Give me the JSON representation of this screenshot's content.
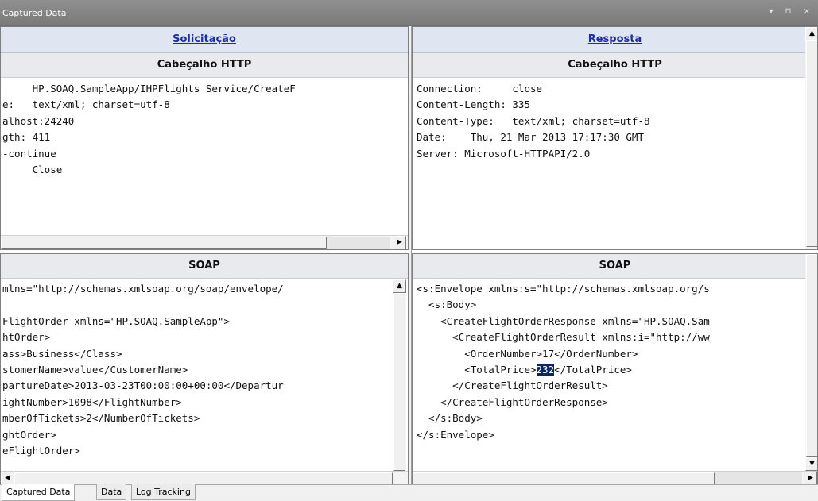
{
  "window": {
    "title": "Captured Data",
    "controls": "▾ ⊓ ×"
  },
  "request": {
    "header": "Solicitação",
    "http_title": "Cabeçalho HTTP",
    "http_lines": [
      "     HP.SOAQ.SampleApp/IHPFlights_Service/CreateF",
      "e:   text/xml; charset=utf-8",
      "alhost:24240",
      "gth: 411",
      "-continue",
      "     Close"
    ],
    "soap_title": "SOAP",
    "soap_lines": [
      "mlns=\"http://schemas.xmlsoap.org/soap/envelope/",
      "",
      "FlightOrder xmlns=\"HP.SOAQ.SampleApp\">",
      "htOrder>",
      "ass>Business</Class>",
      "stomerName>value</CustomerName>",
      "partureDate>2013-03-23T00:00:00+00:00</Departur",
      "ightNumber>1098</FlightNumber>",
      "mberOfTickets>2</NumberOfTickets>",
      "ghtOrder>",
      "eFlightOrder>"
    ]
  },
  "response": {
    "header": "Resposta",
    "http_title": "Cabeçalho HTTP",
    "http_lines": [
      "Connection:     close",
      "Content-Length: 335",
      "Content-Type:   text/xml; charset=utf-8",
      "Date:    Thu, 21 Mar 2013 17:17:30 GMT",
      "Server: Microsoft-HTTPAPI/2.0"
    ],
    "soap_title": "SOAP",
    "soap_lines": [
      "<s:Envelope xmlns:s=\"http://schemas.xmlsoap.org/s",
      "  <s:Body>",
      "    <CreateFlightOrderResponse xmlns=\"HP.SOAQ.Sam",
      "      <CreateFlightOrderResult xmlns:i=\"http://ww",
      "        <OrderNumber>17</OrderNumber>",
      "        <TotalPrice>",
      "      </CreateFlightOrderResult>",
      "    </CreateFlightOrderResponse>",
      "  </s:Body>",
      "</s:Envelope>"
    ],
    "selected_text": "232",
    "total_price_close": "</TotalPrice>"
  },
  "scroll_arrows": {
    "left": "◀",
    "right": "▶",
    "up": "▲",
    "down": "▼"
  },
  "tabs": [
    {
      "label": "Captured Data",
      "active": true
    },
    {
      "label": "Data",
      "active": false
    },
    {
      "label": "Log Tracking",
      "active": false
    }
  ]
}
